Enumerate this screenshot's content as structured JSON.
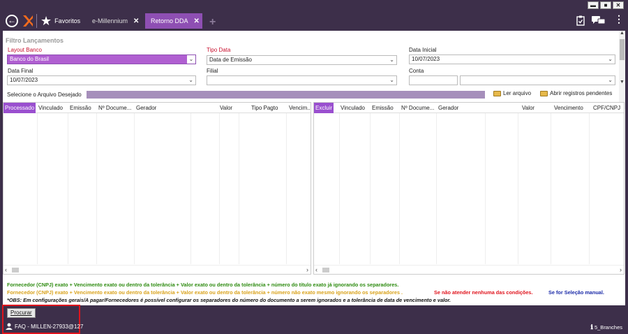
{
  "window": {
    "controls": [
      "▬",
      "■",
      "✕"
    ]
  },
  "topbar": {
    "favorites_label": "Favoritos",
    "tabs": [
      {
        "label": "e-Millennium",
        "close": "✕"
      },
      {
        "label": "Retorno DDA",
        "close": "✕"
      }
    ],
    "add_tab": "+"
  },
  "filter": {
    "title": "Filtro Lançamentos",
    "layout_banco_label": "Layout Banco",
    "layout_banco_value": "Banco do Brasil",
    "tipo_data_label": "Tipo Data",
    "tipo_data_value": "Data de Emissão",
    "data_inicial_label": "Data Inicial",
    "data_inicial_value": "10/07/2023",
    "data_final_label": "Data Final",
    "data_final_value": "10/07/2023",
    "filial_label": "Filial",
    "filial_value": "",
    "conta_label": "Conta",
    "conta_value": ""
  },
  "file_select": {
    "label": "Selecione o Arquivo Desejado",
    "read_file": "Ler arquivo",
    "open_pending": "Abrir registros pendentes"
  },
  "left_grid": {
    "columns": [
      "Processado",
      "Vinculado",
      "Emissão",
      "Nº Docume...",
      "Gerador",
      "Valor",
      "Tipo Pagto",
      "Vencim..."
    ]
  },
  "right_grid": {
    "columns": [
      "Excluir",
      "Vinculado",
      "Emissão",
      "Nº Docume...",
      "Gerador",
      "Valor",
      "Vencimento",
      "CPF/CNPJ"
    ]
  },
  "legend": {
    "green": "Fornecedor (CNPJ) exato + Vencimento exato ou dentro da tolerância + Valor exato ou dentro da tolerância + número do título exato já ignorando os separadores.",
    "yellow": "Fornecedor (CNPJ) exato + Vencimento exato ou dentro da tolerância + Valor exato ou dentro da tolerância + número não exato mesmo ignorando os separadores .",
    "red": "Se não atender nenhuma das condições.",
    "blue": "Se for Seleção manual.",
    "obs": "*OBS: Em configurações gerais/A pagar/Fornecedores é possível configurar os separadores do número do documento a serem ignorados e a tolerância de data de vencimento e valor."
  },
  "footer": {
    "search_button": "Procurar",
    "user": "FAQ - MILLEN-27933@127",
    "branches": "5_Branches"
  },
  "colors": {
    "titlebar": "#3d2f4a",
    "accent": "#8e4fb3",
    "green": "#2e8b10",
    "yellow": "#d9a21b",
    "red": "#e0141d",
    "blue": "#1a2aa8"
  }
}
